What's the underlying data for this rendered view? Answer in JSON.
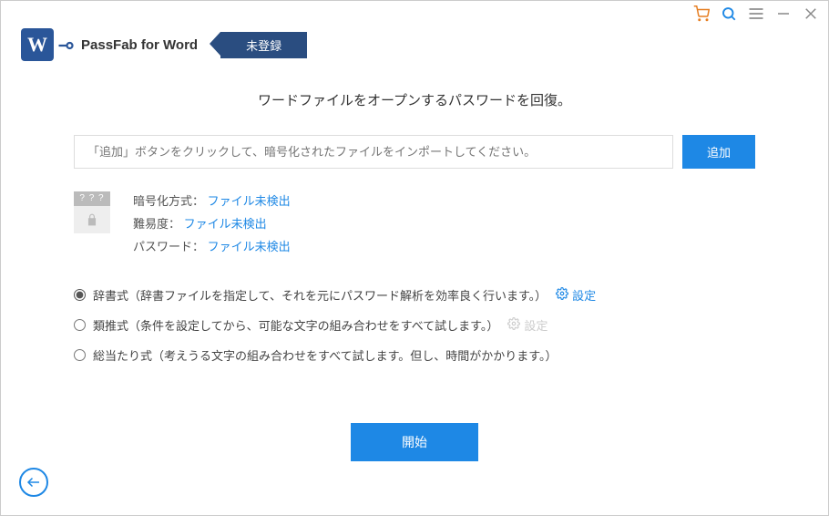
{
  "titlebar": {
    "cart_icon": "cart-icon",
    "search_icon": "search-icon",
    "menu_icon": "menu-icon",
    "minimize_icon": "minimize-icon",
    "close_icon": "close-icon"
  },
  "header": {
    "app_title": "PassFab for Word",
    "registration_status": "未登録"
  },
  "main": {
    "page_title": "ワードファイルをオープンするパスワードを回復。",
    "import_placeholder": "「追加」ボタンをクリックして、暗号化されたファイルをインポートしてください。",
    "add_button": "追加",
    "file_info": {
      "thumb_placeholder": "? ? ?",
      "encryption_label": "暗号化方式：",
      "encryption_value": "ファイル未検出",
      "difficulty_label": "難易度：",
      "difficulty_value": "ファイル未検出",
      "password_label": "パスワード：",
      "password_value": "ファイル未検出"
    },
    "methods": {
      "dictionary": {
        "label": "辞書式（辞書ファイルを指定して、それを元にパスワード解析を効率良く行います。）",
        "settings": "設定",
        "selected": true
      },
      "mask": {
        "label": "類推式（条件を設定してから、可能な文字の組み合わせをすべて試します。）",
        "settings": "設定",
        "selected": false
      },
      "brute": {
        "label": "総当たり式（考えうる文字の組み合わせをすべて試します。但し、時間がかかります。）",
        "selected": false
      }
    },
    "start_button": "開始"
  }
}
